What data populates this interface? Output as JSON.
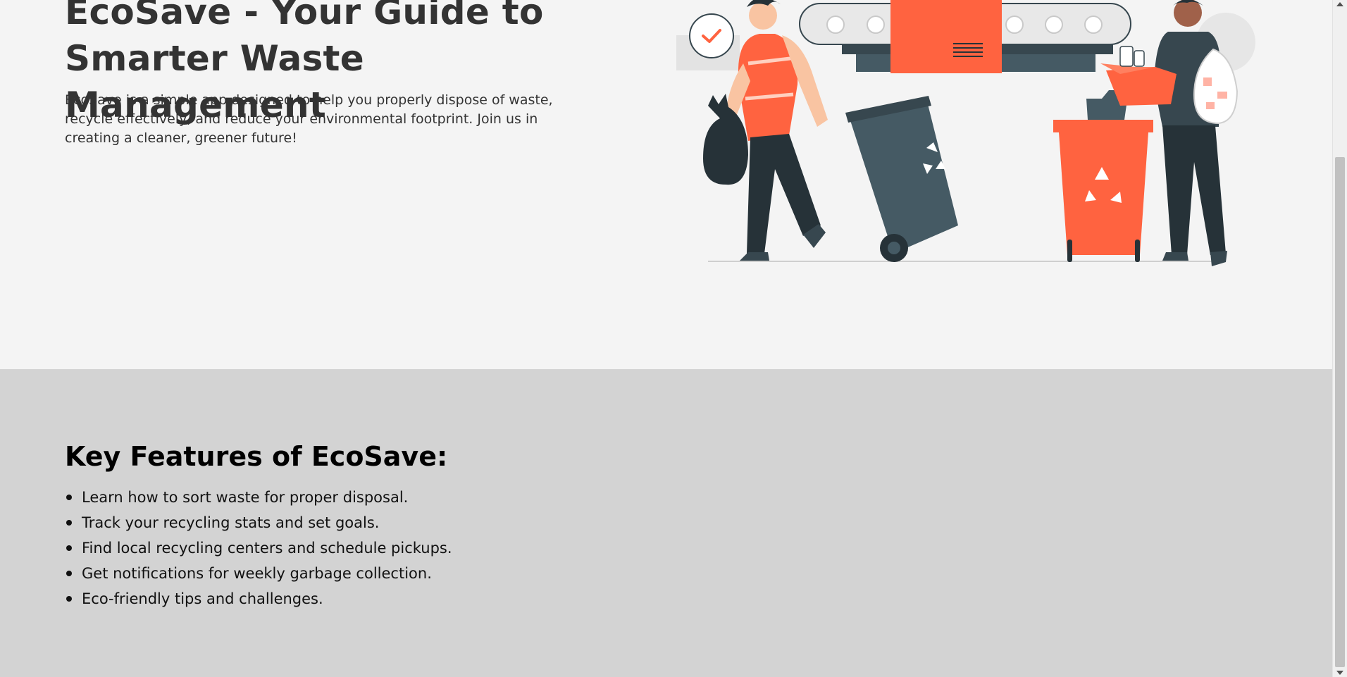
{
  "hero": {
    "title": "EcoSave - Your Guide to Smarter Waste Management",
    "description": "EcoSave is a simple app designed to help you properly dispose of waste, recycle effectively, and reduce your environmental footprint. Join us in creating a cleaner, greener future!"
  },
  "illustration": {
    "icons": [
      "check-icon",
      "recycle-icon",
      "trash-bag-icon",
      "conveyor-icon",
      "cardboard-box-icon"
    ]
  },
  "features": {
    "title": "Key Features of EcoSave:",
    "items": [
      "Learn how to sort waste for proper disposal.",
      "Track your recycling stats and set goals.",
      "Find local recycling centers and schedule pickups.",
      "Get notifications for weekly garbage collection.",
      "Eco-friendly tips and challenges."
    ]
  },
  "colors": {
    "accent": "#ff6340",
    "dark_teal": "#37474f",
    "hero_bg": "#f4f4f4",
    "features_bg": "#d3d3d3"
  }
}
